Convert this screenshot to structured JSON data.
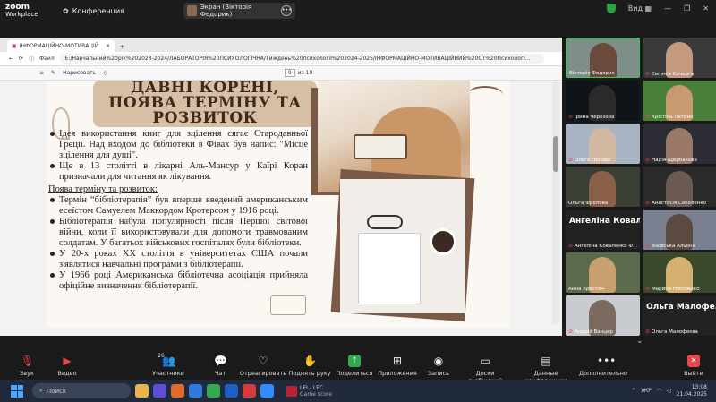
{
  "zoom": {
    "logo_top": "zoom",
    "logo_bottom": "Workplace",
    "conference_label": "Конференция",
    "screen_label": "Экран (Вікторія Федорик)",
    "view_label": "Вид"
  },
  "browser": {
    "tab_title": "ІНФОРМАЦІЙНО-МОТИВАЦІЙ",
    "file_label": "Файл",
    "url": "E:/Навчальний%20рік%202023-2024/ЛАБОРАТОРІЯ%20ПСИХОЛОГІЧНА/Тиждень%20психології%202024-2025/ІНФОРМАЦІЙНО-МОТИВАЦІЙНИЙ%20СТ%20Психологі...",
    "draw_label": "Нарисовать",
    "page_current": "9",
    "page_total": "из 10"
  },
  "slide": {
    "title_l1": "ДАВНІ КОРЕНІ,",
    "title_l2": "ПОЯВА ТЕРМІНУ ТА",
    "title_l3": "РОЗВИТОК",
    "b1": "Ідея використання книг для зцілення сягає Стародавньої Греції. Над входом до бібліотеки в Фівах був напис: \"Місце зцілення для душі\".",
    "b2": "Ще в 13 столітті в лікарні Аль-Мансур у Каїрі Коран призначали для читання як лікування.",
    "sub": "Поява терміну та розвиток:",
    "b3": "Термін “бібліотерапія” був вперше введений американським есеїстом Самуелем Маккордом Кротерсом у 1916 році.",
    "b4": "Бібліотерапія набула популярності після Першої світової війни, коли її використовували для допомоги травмованим солдатам. У багатьох військових госпіталях були бібліотеки.",
    "b5": "У 20-х роках XX століття в університетах США почали з'являтися навчальні програми з бібліотерапії.",
    "b6": "У 1966 році Американська бібліотечна асоціація прийняла офіційне визначення бібліотерапії."
  },
  "participants": [
    {
      "name": "Вікторія Федорик",
      "active": true,
      "face": "#6a4a3a",
      "bg": "#7d8f88",
      "muted": false
    },
    {
      "name": "Євгенія Кочерга",
      "face": "#c49a7e",
      "bg": "#3a3a3a",
      "muted": true
    },
    {
      "name": "Ірина Черезова",
      "face": "#2a2a2a",
      "bg": "#0e1418",
      "muted": true
    },
    {
      "name": "Крістіна Петрик",
      "face": "#c99a70",
      "bg": "#4a7f3a",
      "muted": true
    },
    {
      "name": "Ольга Попова",
      "face": "#d2b8a0",
      "bg": "#a8b4c2",
      "muted": true
    },
    {
      "name": "Надія Щербакова",
      "face": "#9a7a66",
      "bg": "#2c2c34",
      "muted": true
    },
    {
      "name": "Ольга Фролова",
      "face": "#8a6048",
      "bg": "#3a3f34",
      "muted": false
    },
    {
      "name": "Анастасія Соколенко",
      "face": "#6a5a50",
      "bg": "#2a2a2a",
      "muted": true
    },
    {
      "name": "Ангеліна Коваленко Ф...",
      "big": "Ангеліна Ковал...",
      "muted": true
    },
    {
      "name": "Язовська Альона",
      "face": "#5a4a40",
      "bg": "#7a8090",
      "muted": true
    },
    {
      "name": "Анна Христич",
      "face": "#c8a070",
      "bg": "#5a6a4a",
      "muted": false
    },
    {
      "name": "Марина Ніколенко",
      "face": "#d6b070",
      "bg": "#3a4a2a",
      "muted": true
    },
    {
      "name": "Андрій Ванцер",
      "face": "#7a6a60",
      "bg": "#c8ccd0",
      "muted": true
    },
    {
      "name": "Ольга Малофеєва",
      "big": "Ольга Малофе...",
      "muted": true
    }
  ],
  "toolbar": {
    "audio": "Звук",
    "video": "Видео",
    "participants": "Участники",
    "participants_count": "26",
    "chat": "Чат",
    "react": "Отреагировать",
    "raise": "Поднять руку",
    "share": "Поделиться",
    "apps": "Приложения",
    "record": "Запись",
    "boards": "Доски сообщений",
    "data": "Данные конференции",
    "more": "Дополнительно",
    "leave": "Выйти"
  },
  "taskbar": {
    "search": "Поиск",
    "game_title": "LEI - LFC",
    "game_sub": "Game score",
    "lang": "УКР",
    "time": "13:08",
    "date": "21.04.2025"
  }
}
